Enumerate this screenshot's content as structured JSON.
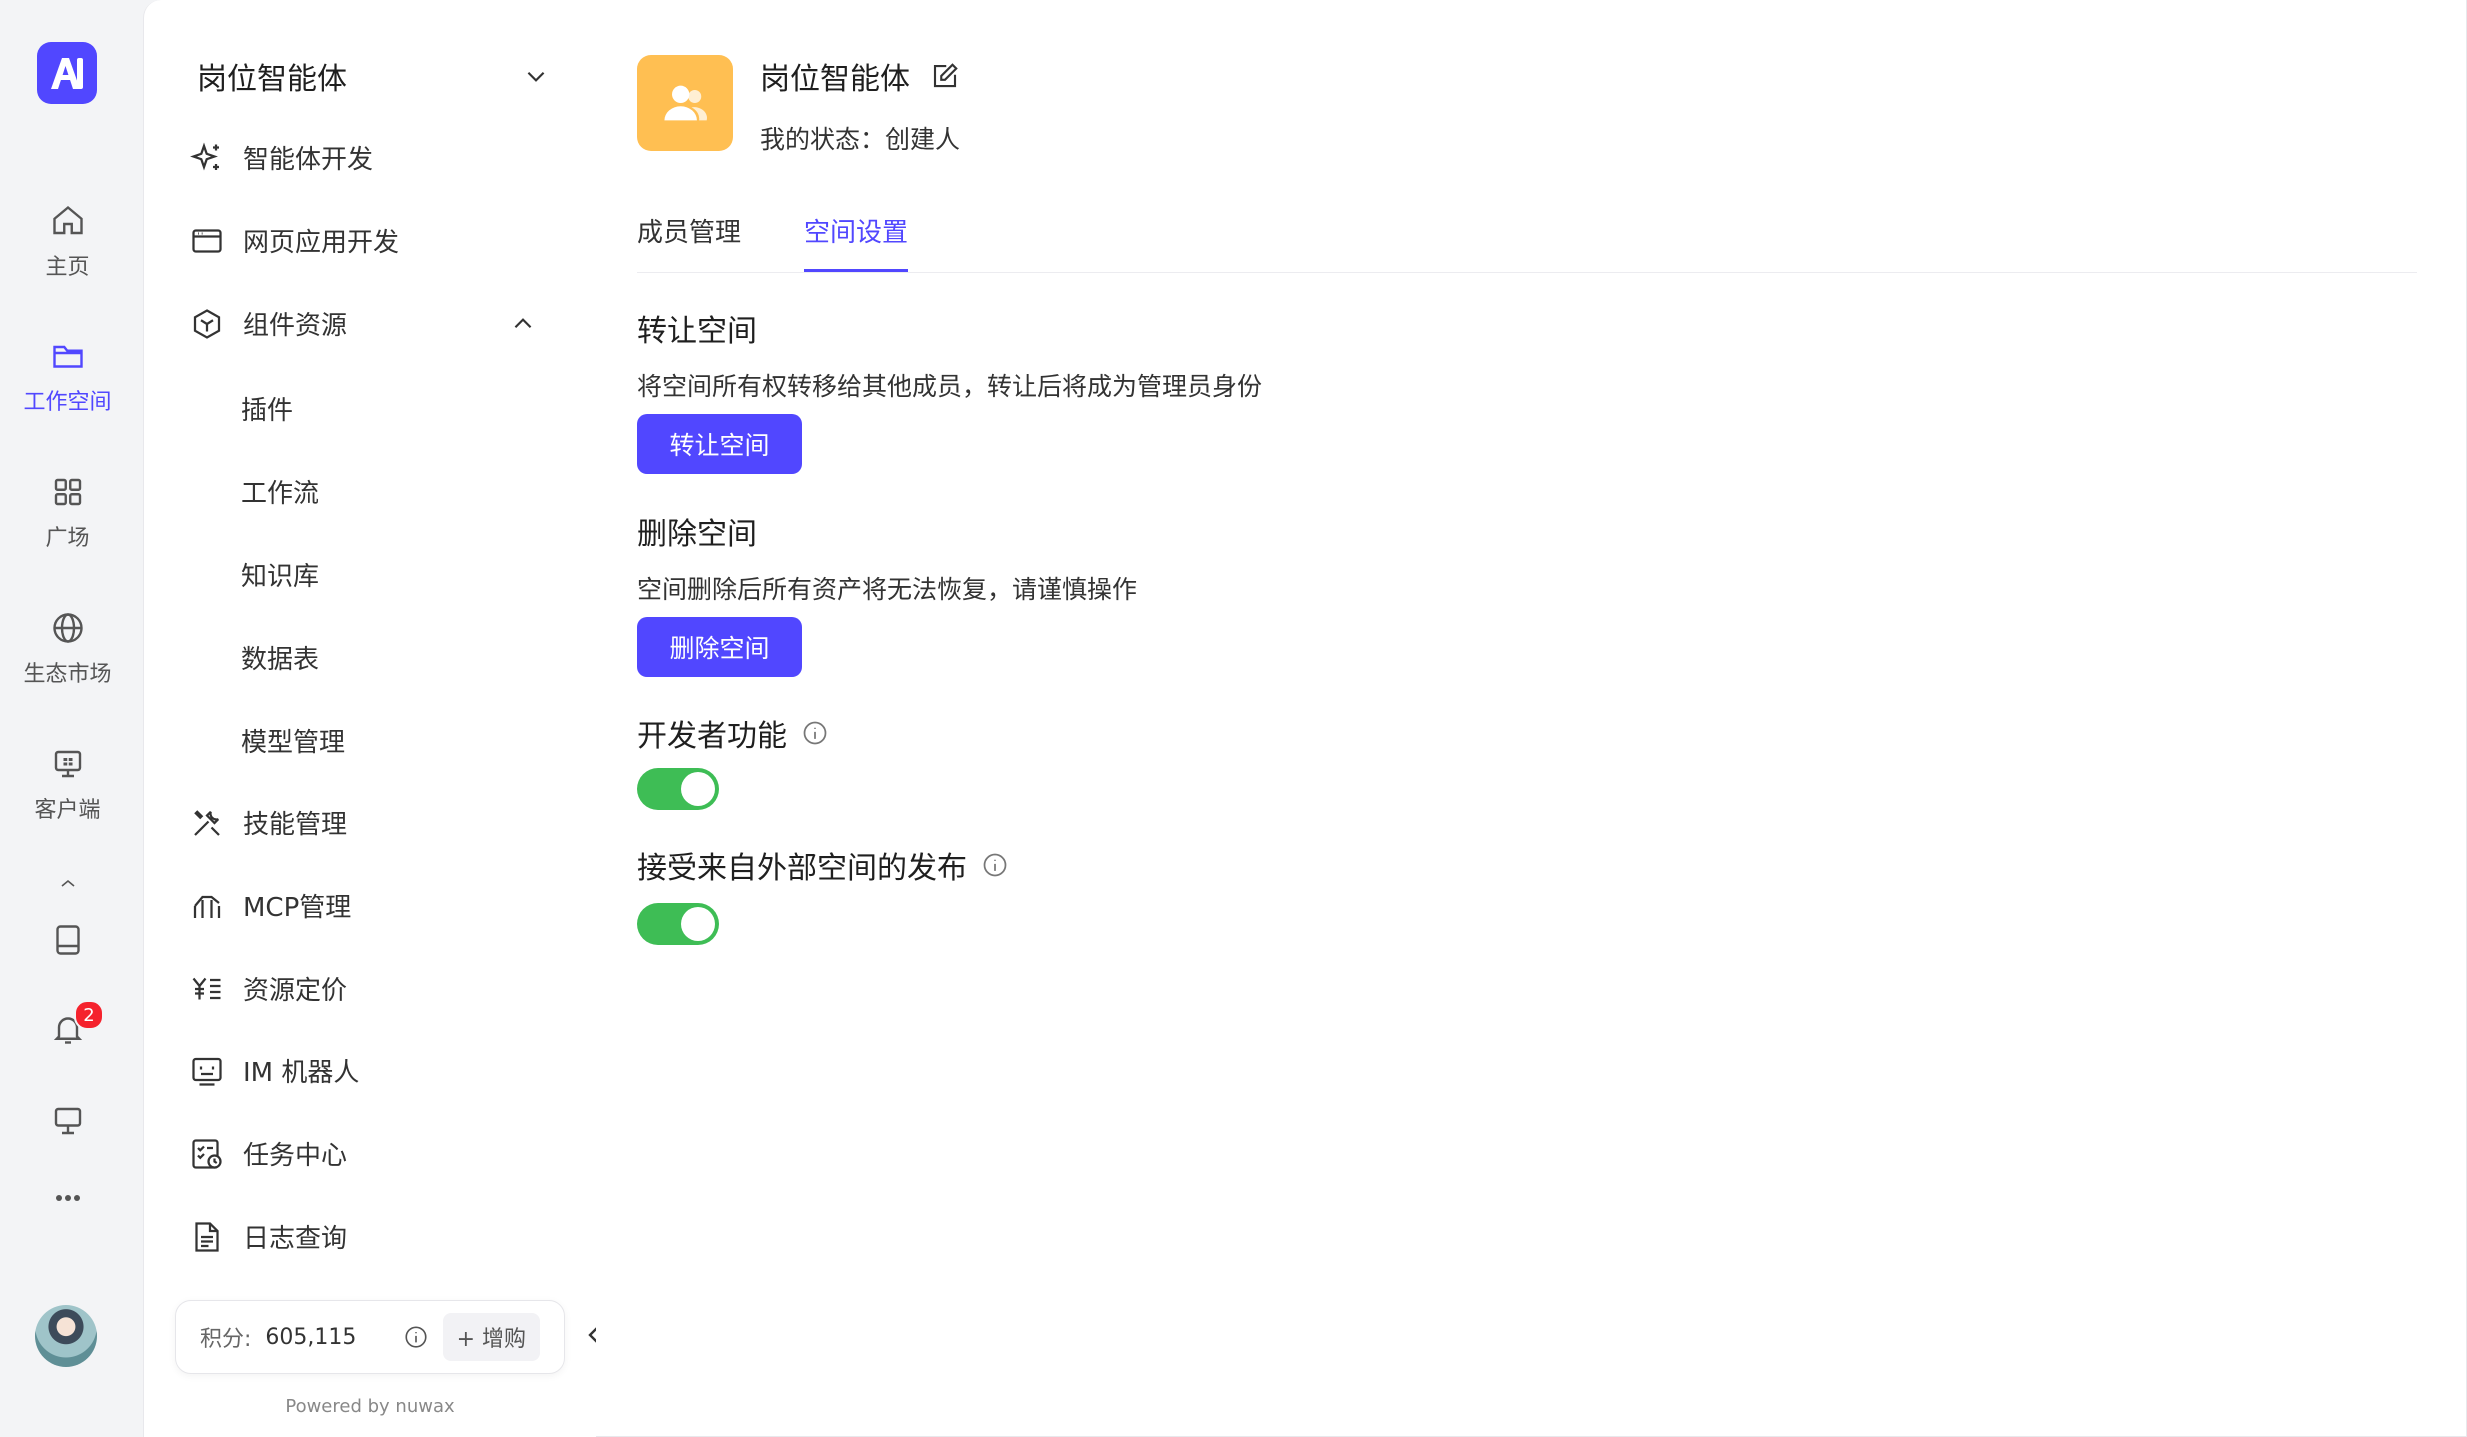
{
  "rail": {
    "items": [
      {
        "label": "主页",
        "icon": "home-icon"
      },
      {
        "label": "工作空间",
        "icon": "folder-icon",
        "active": true
      },
      {
        "label": "广场",
        "icon": "grid-icon"
      },
      {
        "label": "生态市场",
        "icon": "globe-icon"
      },
      {
        "label": "客户端",
        "icon": "desktop-client-icon"
      }
    ],
    "notification_count": "2"
  },
  "sidebar": {
    "space_name": "岗位智能体",
    "menu": {
      "agent_dev": "智能体开发",
      "web_dev": "网页应用开发",
      "components": "组件资源",
      "plugin": "插件",
      "workflow": "工作流",
      "knowledge": "知识库",
      "datatable": "数据表",
      "models": "模型管理",
      "skills": "技能管理",
      "mcp": "MCP管理",
      "pricing": "资源定价",
      "im_bot": "IM 机器人",
      "tasks": "任务中心",
      "logs": "日志查询"
    },
    "points": {
      "label": "积分:",
      "value": "605,115",
      "buy": "+ 增购"
    },
    "powered_by": "Powered by nuwax"
  },
  "main": {
    "title": "岗位智能体",
    "status": "我的状态：创建人",
    "tabs": {
      "members": "成员管理",
      "settings": "空间设置"
    },
    "transfer": {
      "title": "转让空间",
      "desc": "将空间所有权转移给其他成员，转让后将成为管理员身份",
      "button": "转让空间"
    },
    "delete": {
      "title": "删除空间",
      "desc": "空间删除后所有资产将无法恢复，请谨慎操作",
      "button": "删除空间"
    },
    "dev_features": {
      "title": "开发者功能",
      "enabled": true
    },
    "external_publish": {
      "title": "接受来自外部空间的发布",
      "enabled": true
    }
  },
  "colors": {
    "accent": "#5147ff",
    "toggle_on": "#3ebd55",
    "space_icon": "#ffbf52",
    "badge": "#f5222d"
  }
}
